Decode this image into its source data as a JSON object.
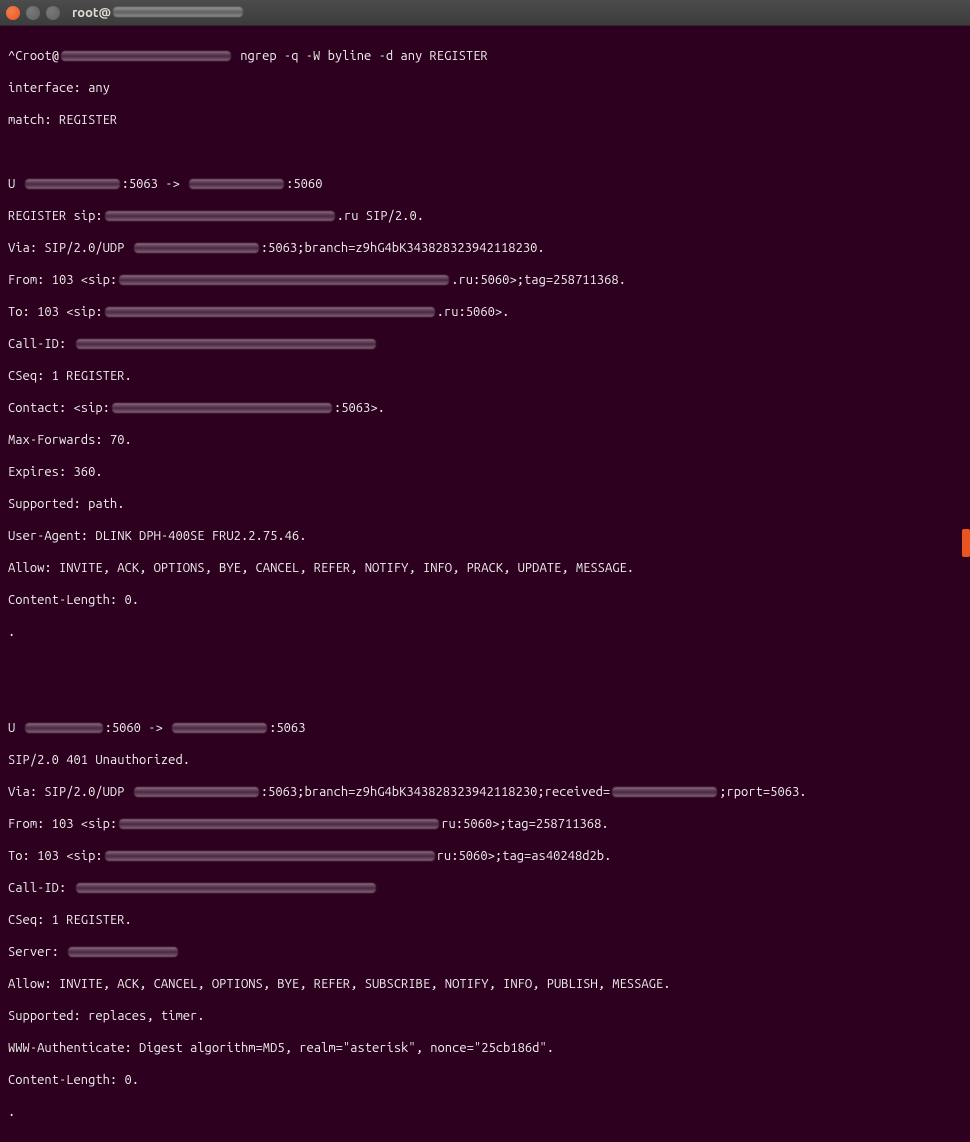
{
  "titlebar": {
    "title": "root@"
  },
  "lines": {
    "l1a": "^Croot@",
    "l1b": " ngrep -q -W byline -d any REGISTER",
    "l2": "interface: any",
    "l3": "match: REGISTER",
    "l4": "",
    "l5a": "U ",
    "l5b": ":5063 -> ",
    "l5c": ":5060",
    "l6a": "REGISTER sip:",
    "l6b": ".ru SIP/2.0.",
    "l7a": "Via: SIP/2.0/UDP ",
    "l7b": ":5063;branch=z9hG4bK343828323942118230.",
    "l8a": "From: 103 <sip:",
    "l8b": ".ru:5060>;tag=258711368.",
    "l9a": "To: 103 <sip:",
    "l9b": ".ru:5060>.",
    "l10a": "Call-ID:",
    "l11": "CSeq: 1 REGISTER.",
    "l12a": "Contact: <sip:",
    "l12b": ":5063>.",
    "l13": "Max-Forwards: 70.",
    "l14": "Expires: 360.",
    "l15": "Supported: path.",
    "l16": "User-Agent: DLINK DPH-400SE FRU2.2.75.46.",
    "l17": "Allow: INVITE, ACK, OPTIONS, BYE, CANCEL, REFER, NOTIFY, INFO, PRACK, UPDATE, MESSAGE.",
    "l18": "Content-Length: 0.",
    "l19": ".",
    "l20": "",
    "l21": "",
    "l22a": "U ",
    "l22b": ":5060 -> ",
    "l22c": ":5063",
    "l23": "SIP/2.0 401 Unauthorized.",
    "l24a": "Via: SIP/2.0/UDP ",
    "l24b": ":5063;branch=z9hG4bK343828323942118230;received=",
    "l24c": ";rport=5063.",
    "l25a": "From: 103 <sip:",
    "l25b": "ru:5060>;tag=258711368.",
    "l26a": "To: 103 <sip:",
    "l26b": "ru:5060>;tag=as40248d2b.",
    "l27a": "Call-ID:",
    "l28": "CSeq: 1 REGISTER.",
    "l29a": "Server: ",
    "l30": "Allow: INVITE, ACK, CANCEL, OPTIONS, BYE, REFER, SUBSCRIBE, NOTIFY, INFO, PUBLISH, MESSAGE.",
    "l31": "Supported: replaces, timer.",
    "l32": "WWW-Authenticate: Digest algorithm=MD5, realm=\"asterisk\", nonce=\"25cb186d\".",
    "l33": "Content-Length: 0.",
    "l34": "."
  }
}
